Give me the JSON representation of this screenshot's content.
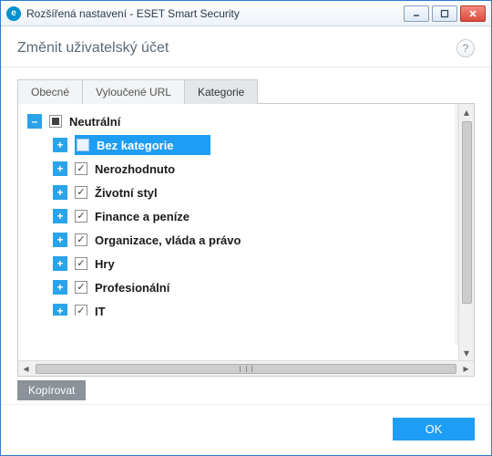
{
  "window": {
    "title": "Rozšířená nastavení - ESET Smart Security",
    "app_icon_letter": "e"
  },
  "header": {
    "title": "Změnit uživatelský účet",
    "help_glyph": "?"
  },
  "tabs": [
    {
      "label": "Obecné",
      "active": false
    },
    {
      "label": "Vyloučené URL",
      "active": false
    },
    {
      "label": "Kategorie",
      "active": true
    }
  ],
  "tree": {
    "root": {
      "label": "Neutrální",
      "state": "indeterminate",
      "expander": "minus"
    },
    "children": [
      {
        "label": "Bez kategorie",
        "state": "unchecked",
        "selected": true
      },
      {
        "label": "Nerozhodnuto",
        "state": "checked"
      },
      {
        "label": "Životní styl",
        "state": "checked"
      },
      {
        "label": "Finance a peníze",
        "state": "checked"
      },
      {
        "label": "Organizace, vláda a právo",
        "state": "checked"
      },
      {
        "label": "Hry",
        "state": "checked"
      },
      {
        "label": "Profesionální",
        "state": "checked"
      },
      {
        "label": "IT",
        "state": "checked",
        "clipped": true
      }
    ]
  },
  "buttons": {
    "copy": "Kopírovat",
    "ok": "OK"
  }
}
